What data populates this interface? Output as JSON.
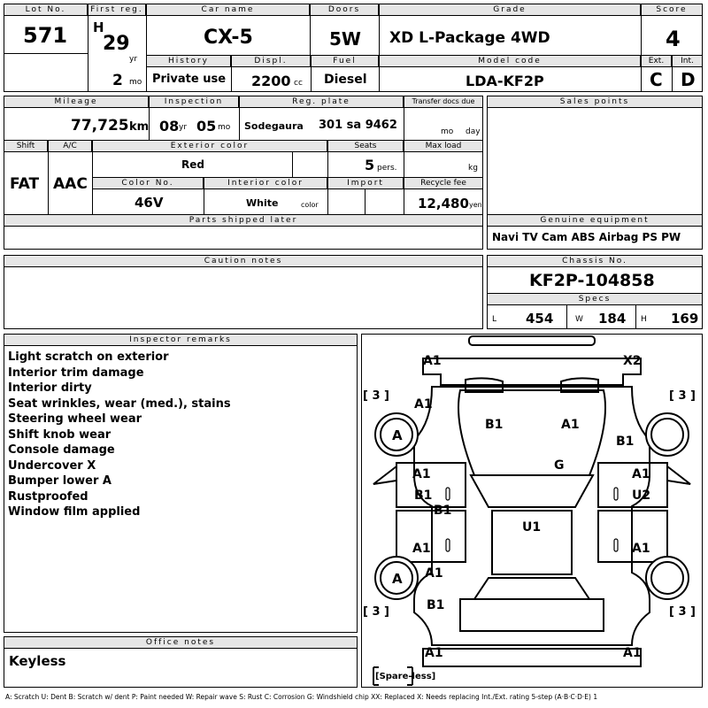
{
  "header": {
    "lot_no_label": "Lot No.",
    "lot_no": "571",
    "first_reg_label": "First reg.",
    "era_prefix": "H",
    "year": "29",
    "year_unit": "yr",
    "month": "2",
    "month_unit": "mo",
    "car_name_label": "Car name",
    "car_name": "CX-5",
    "doors_label": "Doors",
    "doors": "5W",
    "grade_label": "Grade",
    "grade": "XD L-Package 4WD",
    "score_label": "Score",
    "score": "4",
    "history_label": "History",
    "history": "Private use",
    "displacement_label": "Displ.",
    "displacement": "2200",
    "displacement_unit": "cc",
    "fuel_label": "Fuel",
    "fuel": "Diesel",
    "model_code_label": "Model code",
    "model_code": "LDA-KF2P",
    "ext_label": "Ext.",
    "int_label": "Int.",
    "exterior_grade": "C",
    "interior_grade": "D"
  },
  "row2": {
    "mileage_label": "Mileage",
    "mileage": "77,725",
    "mileage_unit": "km",
    "inspection_label": "Inspection",
    "insp_year": "08",
    "insp_year_unit": "yr",
    "insp_month": "05",
    "insp_month_unit": "mo",
    "plate_label": "Reg. plate",
    "plate_region": "Sodegaura",
    "plate_number": "301 sa 9462",
    "transfer_label": "Transfer docs due",
    "transfer_month_unit": "mo",
    "transfer_day_unit": "day",
    "sales_points_label": "Sales points"
  },
  "row3": {
    "shift_label": "Shift",
    "shift": "FAT",
    "ac_label": "A/C",
    "ac": "AAC",
    "ext_color_label": "Exterior color",
    "ext_color": "Red",
    "capacity_label": "Seats",
    "capacity": "5",
    "capacity_unit": "pers.",
    "max_load_label": "Max load",
    "max_load_unit": "kg",
    "color_no_label": "Color No.",
    "color_no": "46V",
    "int_color_label": "Interior color",
    "int_color": "White",
    "int_color_suffix": "color",
    "import_label": "Import",
    "recycle_label": "Recycle fee",
    "recycle": "12,480",
    "recycle_unit": "yen"
  },
  "equipment": {
    "later_parts_label": "Parts shipped later",
    "genuine_label": "Genuine equipment",
    "items": "Navi TV Cam ABS Airbag PS PW"
  },
  "notes": {
    "caution_label": "Caution notes",
    "chassis_label": "Chassis No.",
    "chassis_no": "KF2P-104858",
    "specs_label": "Specs",
    "length_label": "L",
    "length": "454",
    "width_label": "W",
    "width": "184",
    "height_label": "H",
    "height": "169"
  },
  "inspector": {
    "label": "Inspector remarks",
    "lines": [
      "Light scratch on exterior",
      "Interior trim damage",
      "Interior dirty",
      "Seat wrinkles, wear (med.), stains",
      "Steering wheel wear",
      "Shift knob wear",
      "Console damage",
      "Undercover X",
      "Bumper lower A",
      "Rustproofed",
      "Window film applied"
    ]
  },
  "office": {
    "label": "Office notes",
    "text": "Keyless"
  },
  "diagram": {
    "marks": {
      "front_left": "A1",
      "front_right": "X2",
      "fender_fl": "A1",
      "wheel_fl": "A",
      "hood_left": "B1",
      "hood_right": "A1",
      "fender_fr": "B1",
      "windshield": "G",
      "door_fl": "A1",
      "door_fr": "A1",
      "pillar_l": "B1",
      "pillar_r": "U2",
      "sill_l": "B1",
      "roof": "U1",
      "door_rl": "A1",
      "door_rr": "A1",
      "wheel_rl": "A",
      "fender_rl": "A1",
      "fender_rl2": "B1",
      "rear_left": "A1",
      "rear_right": "A1"
    },
    "tire_tl": "[ 3 ]",
    "tire_tr": "[ 3 ]",
    "tire_bl": "[ 3 ]",
    "tire_br": "[ 3 ]",
    "spare": "[Spare-less]"
  },
  "legend": "A: Scratch U: Dent B: Scratch w/ dent P: Paint needed W: Repair wave S: Rust C: Corrosion G: Windshield chip XX: Replaced X: Needs replacing Int./Ext. rating 5-step (A·B·C·D·E) 1"
}
